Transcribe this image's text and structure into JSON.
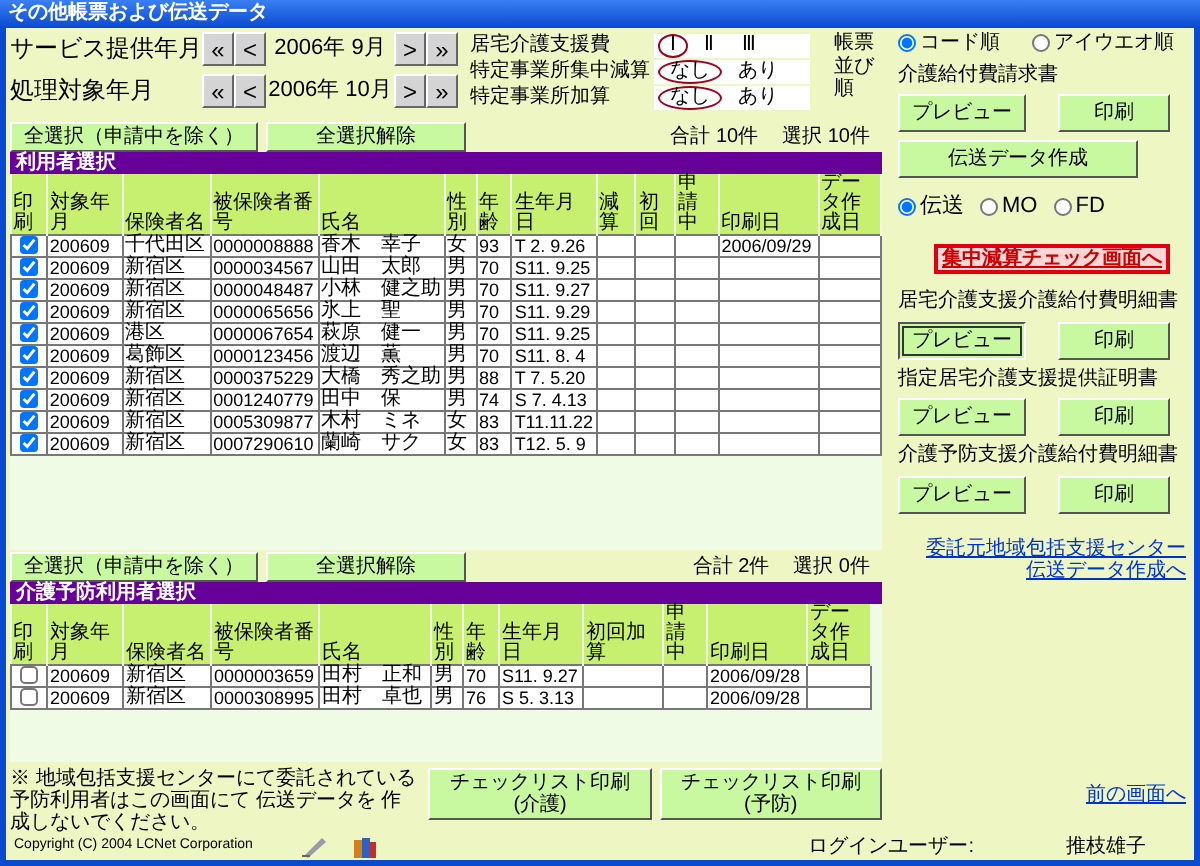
{
  "window": {
    "title": "その他帳票および伝送データ"
  },
  "periods": [
    {
      "label": "サービス提供年月",
      "prev": [
        "«",
        "<"
      ],
      "value": "2006年 9月",
      "next": [
        ">",
        "»"
      ]
    },
    {
      "label": "処理対象年月",
      "prev": [
        "«",
        "<"
      ],
      "value": "2006年 10月",
      "next": [
        ">",
        "»"
      ]
    }
  ],
  "options": [
    {
      "label": "居宅介護支援費",
      "choices": [
        {
          "text": "Ⅰ",
          "selected": true
        },
        {
          "text": "Ⅱ",
          "selected": false
        },
        {
          "text": "Ⅲ",
          "selected": false
        }
      ]
    },
    {
      "label": "特定事業所集中減算",
      "choices": [
        {
          "text": "なし",
          "selected": true
        },
        {
          "text": "あり",
          "selected": false
        }
      ]
    },
    {
      "label": "特定事業所加算",
      "choices": [
        {
          "text": "なし",
          "selected": true
        },
        {
          "text": "あり",
          "selected": false
        }
      ]
    }
  ],
  "sort": {
    "label": "帳票並び順",
    "choices": [
      {
        "text": "コード順",
        "selected": true
      },
      {
        "text": "アイウエオ順",
        "selected": false
      }
    ]
  },
  "tables": [
    {
      "title": "利用者選択",
      "select_all": "全選択（申請中を除く）",
      "deselect_all": "全選択解除",
      "total": "合計 10件",
      "selected_count": "選択 10件",
      "check_header": "印刷",
      "columns": [
        "対象年月",
        "保険者名",
        "被保険者番号",
        "氏名",
        "性別",
        "年齢",
        "生年月日",
        "減算",
        "初回",
        "申請中",
        "印刷日",
        "データ作成日"
      ],
      "rows": [
        {
          "checked": true,
          "cells": [
            "200609",
            "千代田区",
            "0000008888",
            "香木　幸子",
            "女",
            "93",
            "T 2. 9.26",
            null,
            null,
            null,
            "2006/09/29",
            null
          ]
        },
        {
          "checked": true,
          "cells": [
            "200609",
            "新宿区",
            "0000034567",
            "山田　太郎",
            "男",
            "70",
            "S11. 9.25",
            null,
            null,
            null,
            null,
            null
          ]
        },
        {
          "checked": true,
          "cells": [
            "200609",
            "新宿区",
            "0000048487",
            "小林　健之助",
            "男",
            "70",
            "S11. 9.27",
            null,
            null,
            null,
            null,
            null
          ]
        },
        {
          "checked": true,
          "cells": [
            "200609",
            "新宿区",
            "0000065656",
            "氷上　聖",
            "男",
            "70",
            "S11. 9.29",
            null,
            null,
            null,
            null,
            null
          ]
        },
        {
          "checked": true,
          "cells": [
            "200609",
            "港区",
            "0000067654",
            "萩原　健一",
            "男",
            "70",
            "S11. 9.25",
            null,
            null,
            null,
            null,
            null
          ]
        },
        {
          "checked": true,
          "cells": [
            "200609",
            "葛飾区",
            "0000123456",
            "渡辺　薫",
            "男",
            "70",
            "S11. 8. 4",
            null,
            null,
            null,
            null,
            null
          ]
        },
        {
          "checked": true,
          "cells": [
            "200609",
            "新宿区",
            "0000375229",
            "大橋　秀之助",
            "男",
            "88",
            "T 7. 5.20",
            null,
            null,
            null,
            null,
            null
          ]
        },
        {
          "checked": true,
          "cells": [
            "200609",
            "新宿区",
            "0001240779",
            "田中　保",
            "男",
            "74",
            "S 7. 4.13",
            null,
            null,
            null,
            null,
            null
          ]
        },
        {
          "checked": true,
          "cells": [
            "200609",
            "新宿区",
            "0005309877",
            "木村　ミネ",
            "女",
            "83",
            "T11.11.22",
            null,
            null,
            null,
            null,
            null
          ]
        },
        {
          "checked": true,
          "cells": [
            "200609",
            "新宿区",
            "0007290610",
            "蘭崎　サク",
            "女",
            "83",
            "T12. 5. 9",
            null,
            null,
            null,
            null,
            null
          ]
        }
      ]
    },
    {
      "title": "介護予防利用者選択",
      "select_all": "全選択（申請中を除く）",
      "deselect_all": "全選択解除",
      "total": "合計 2件",
      "selected_count": "選択 0件",
      "check_header": "印刷",
      "columns": [
        "対象年月",
        "保険者名",
        "被保険者番号",
        "氏名",
        "性別",
        "年齢",
        "生年月日",
        "初回加算",
        "申請中",
        "印刷日",
        "データ作成日"
      ],
      "rows": [
        {
          "checked": false,
          "cells": [
            "200609",
            "新宿区",
            "0000003659",
            "田村　正和",
            "男",
            "70",
            "S11. 9.27",
            null,
            null,
            "2006/09/28",
            null
          ]
        },
        {
          "checked": false,
          "cells": [
            "200609",
            "新宿区",
            "0000308995",
            "田村　卓也",
            "男",
            "76",
            "S 5. 3.13",
            null,
            null,
            "2006/09/28",
            null
          ]
        }
      ]
    }
  ],
  "note": "※ 地域包括支援センターにて委託されている予防利用者はこの画面にて 伝送データを 作成しないでください。",
  "checklist_buttons": [
    "チェックリスト印刷(介護)",
    "チェックリスト印刷(予防)"
  ],
  "side": [
    {
      "kind": "heading",
      "text": "介護給付費請求書"
    },
    {
      "kind": "buttons",
      "buttons": [
        {
          "text": "プレビュー",
          "pressed": false
        },
        {
          "text": "印刷",
          "pressed": false
        }
      ]
    },
    {
      "kind": "buttons",
      "buttons": [
        {
          "text": "伝送データ作成",
          "pressed": false
        }
      ]
    },
    {
      "kind": "radios",
      "choices": [
        {
          "text": "伝送",
          "selected": true
        },
        {
          "text": "MO",
          "selected": false
        },
        {
          "text": "FD",
          "selected": false
        }
      ]
    },
    {
      "kind": "alert_link",
      "text": "集中減算チェック画面へ"
    },
    {
      "kind": "heading",
      "text": "居宅介護支援介護給付費明細書"
    },
    {
      "kind": "buttons",
      "buttons": [
        {
          "text": "プレビュー",
          "pressed": true
        },
        {
          "text": "印刷",
          "pressed": false
        }
      ]
    },
    {
      "kind": "heading",
      "text": "指定居宅介護支援提供証明書"
    },
    {
      "kind": "buttons",
      "buttons": [
        {
          "text": "プレビュー",
          "pressed": false
        },
        {
          "text": "印刷",
          "pressed": false
        }
      ]
    },
    {
      "kind": "heading",
      "text": "介護予防支援介護給付費明細書"
    },
    {
      "kind": "buttons",
      "buttons": [
        {
          "text": "プレビュー",
          "pressed": false
        },
        {
          "text": "印刷",
          "pressed": false
        }
      ]
    },
    {
      "kind": "link",
      "lines": [
        "委託元地域包括支援センター",
        "伝送データ作成へ"
      ]
    }
  ],
  "back_link": "前の画面へ",
  "footer": {
    "copyright": "Copyright (C) 2004 LCNet Corporation",
    "login_label": "ログインユーザー:",
    "user": "推枝雄子"
  }
}
